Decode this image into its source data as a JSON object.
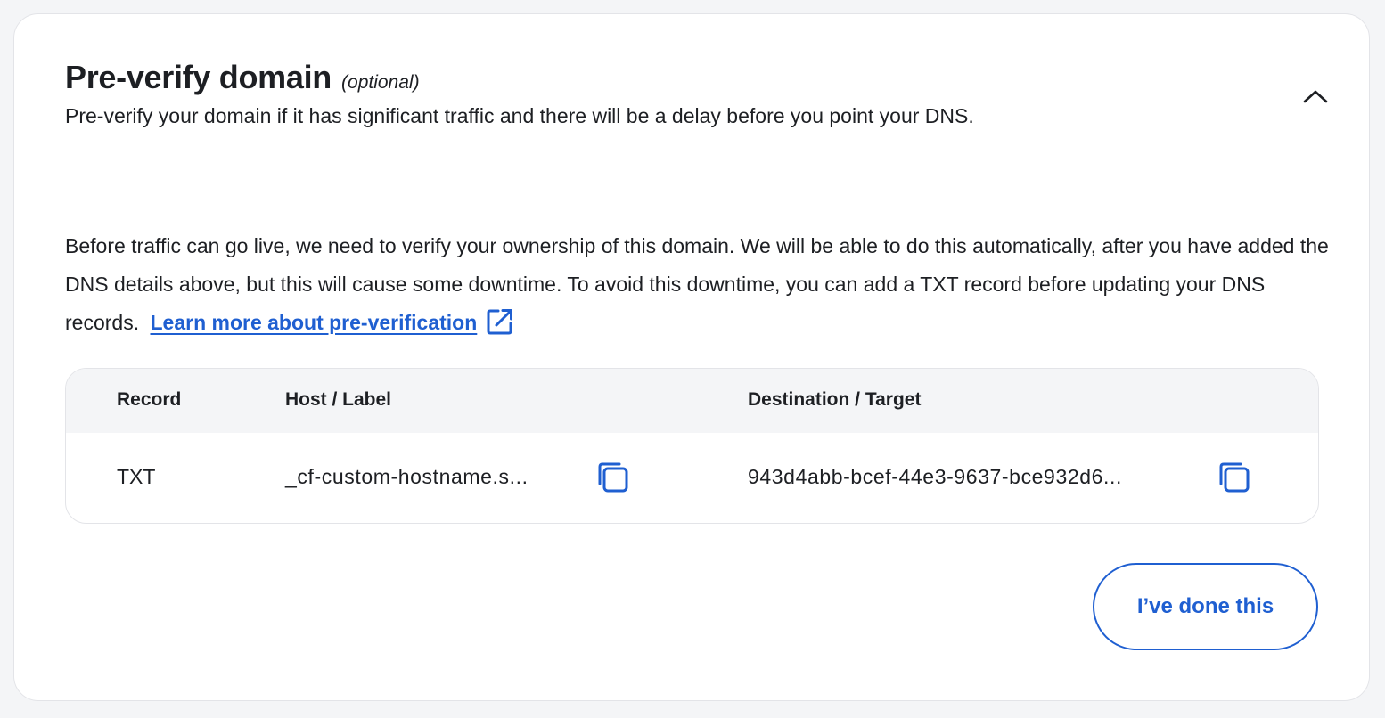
{
  "header": {
    "title": "Pre-verify domain",
    "optional_label": "(optional)",
    "subtitle": "Pre-verify your domain if it has significant traffic and there will be a delay before you point your DNS.",
    "collapse_icon": "chevron-up-icon"
  },
  "body": {
    "description": "Before traffic can go live, we need to verify your ownership of this domain. We will be able to do this automatically, after you have added the DNS details above, but this will cause some downtime. To avoid this downtime, you can add a TXT record before updating your DNS records.",
    "link_text": "Learn more about pre-verification",
    "link_icon": "external-link-icon"
  },
  "table": {
    "columns": [
      "Record",
      "Host / Label",
      "Destination / Target"
    ],
    "rows": [
      {
        "record": "TXT",
        "host": "_cf-custom-hostname.s...",
        "destination": "943d4abb-bcef-44e3-9637-bce932d6..."
      }
    ],
    "copy_icon": "copy-icon"
  },
  "actions": {
    "done_label": "I’ve done this"
  },
  "colors": {
    "accent": "#1f5fd1",
    "text": "#1d1f23",
    "border": "#e3e4e8",
    "header_bg": "#f4f5f7"
  }
}
